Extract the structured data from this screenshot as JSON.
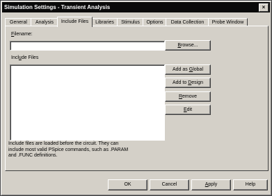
{
  "window": {
    "title": "Simulation Settings - Transient Analysis",
    "close_glyph": "×"
  },
  "tabs": [
    {
      "label": "General",
      "active": false
    },
    {
      "label": "Analysis",
      "active": false
    },
    {
      "label": "Include Files",
      "active": true
    },
    {
      "label": "Libraries",
      "active": false
    },
    {
      "label": "Stimulus",
      "active": false
    },
    {
      "label": "Options",
      "active": false
    },
    {
      "label": "Data Collection",
      "active": false
    },
    {
      "label": "Probe Window",
      "active": false
    }
  ],
  "filename": {
    "label_first": "F",
    "label_rest": "ilename:",
    "value": ""
  },
  "browse": {
    "first": "B",
    "rest": "rowse..."
  },
  "include_files": {
    "label_pre": "Incl",
    "label_u": "u",
    "label_post": "de Files"
  },
  "side_buttons": {
    "add_global": {
      "pre": "Add as ",
      "u": "G",
      "post": "lobal"
    },
    "add_design": {
      "pre": "Add to ",
      "u": "D",
      "post": "esign"
    },
    "remove": {
      "u": "R",
      "post": "emove"
    },
    "edit": {
      "u": "E",
      "post": "dit"
    }
  },
  "note_lines": [
    "Include files are loaded before the circuit.  They can",
    "include most valid PSpice commands, such as .PARAM",
    "and .FUNC definitions."
  ],
  "footer": {
    "ok": "OK",
    "cancel": "Cancel",
    "apply_u": "A",
    "apply_rest": "pply",
    "help": "Help"
  }
}
